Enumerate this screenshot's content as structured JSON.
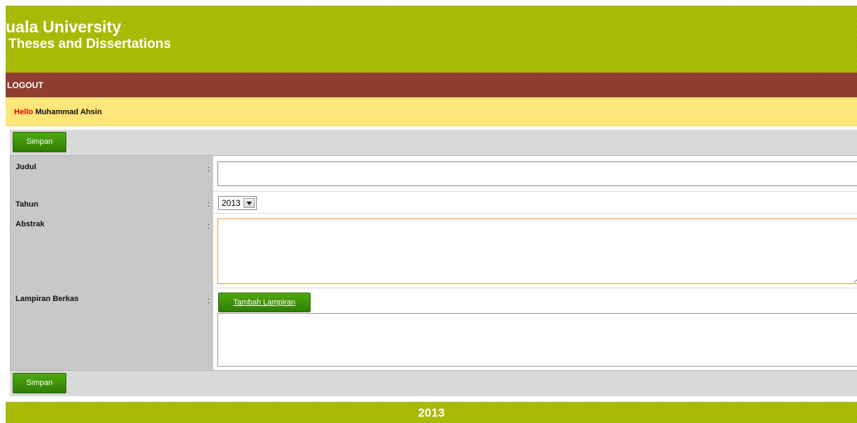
{
  "header": {
    "title": "uala University",
    "subtitle": "Theses and Dissertations"
  },
  "nav": {
    "logout_label": "LOGOUT"
  },
  "greeting": {
    "hello": "Hello",
    "user_name": "Muhammad Ahsin"
  },
  "toolbar": {
    "save_label": "Simpan"
  },
  "form": {
    "judul": {
      "label": "Judul",
      "colon": ":",
      "value": ""
    },
    "tahun": {
      "label": "Tahun",
      "colon": ":",
      "selected": "2013"
    },
    "abstrak": {
      "label": "Abstrak",
      "colon": ":",
      "value": ""
    },
    "lampiran": {
      "label": "Lampiran Berkas",
      "colon": ":",
      "add_button_label": "Tambah Lampiran"
    }
  },
  "footer": {
    "year": "2013"
  },
  "colors": {
    "header_green": "#a6b800",
    "nav_brown": "#8e3d31",
    "greeting_yellow": "#ffe67a",
    "button_green": "#3f9a0b",
    "hello_red": "#e00000"
  },
  "icons": {
    "select_arrow": "chevron-down-icon"
  }
}
